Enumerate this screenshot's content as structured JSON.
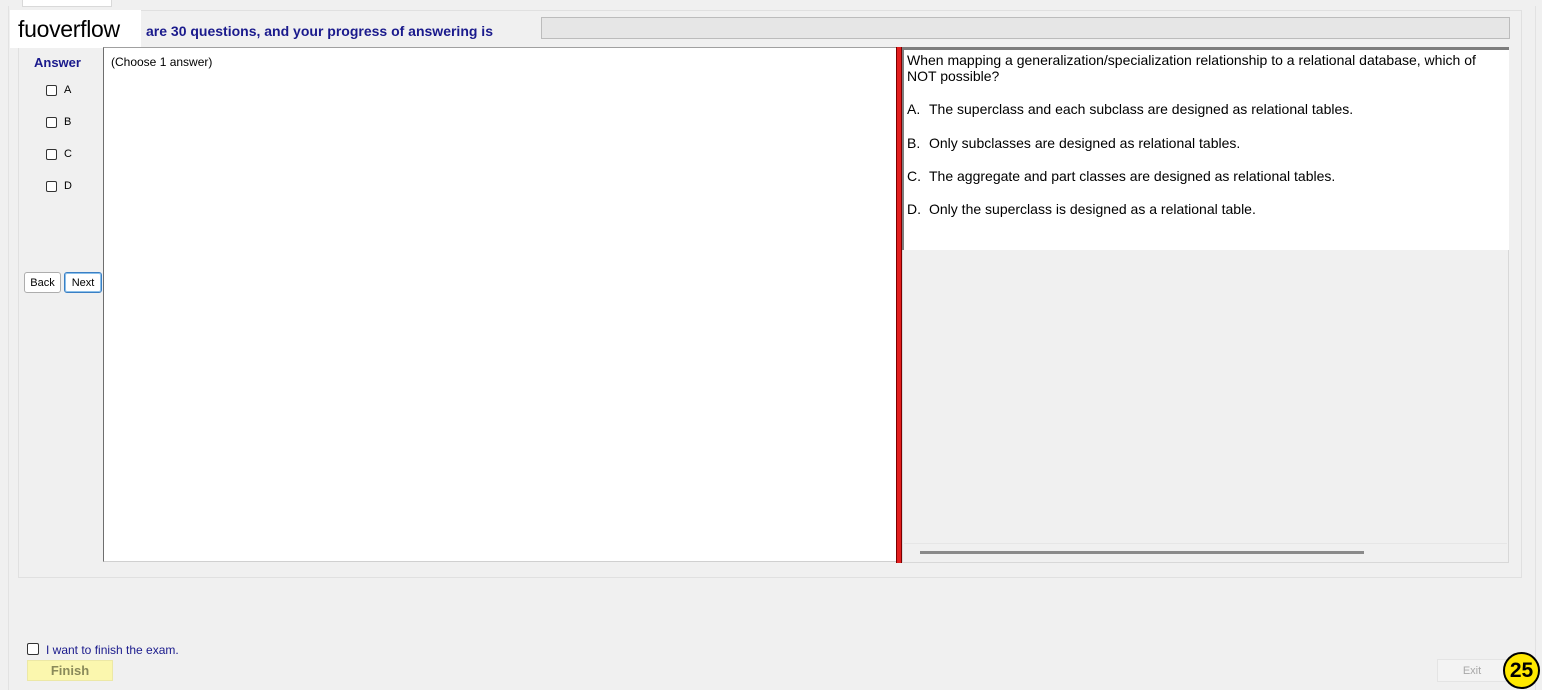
{
  "watermark": "fuoverflow",
  "progress": {
    "text": "are 30 questions, and your progress of answering is",
    "fraction": 0
  },
  "answer_panel": {
    "heading": "Answer",
    "options": [
      "A",
      "B",
      "C",
      "D"
    ],
    "back_label": "Back",
    "next_label": "Next"
  },
  "answer_area": {
    "note": "(Choose 1 answer)"
  },
  "question": {
    "text_line1": "When mapping a generalization/specialization relationship to a relational database, which of",
    "text_line2": "NOT possible?",
    "choices": [
      {
        "letter": "A.",
        "text": "The superclass and each subclass are designed as relational tables."
      },
      {
        "letter": "B.",
        "text": "Only subclasses are designed as relational tables."
      },
      {
        "letter": "C.",
        "text": "The aggregate and part classes are designed as relational tables."
      },
      {
        "letter": "D.",
        "text": "Only the superclass is designed as a relational table."
      }
    ]
  },
  "footer": {
    "finish_check_label": "I want to finish the exam.",
    "finish_label": "Finish",
    "exit_label": "Exit",
    "page_number": "25"
  },
  "colors": {
    "accent_text": "#1a1a8c",
    "splitter": "#e31e1e",
    "finish_button": "#fbf7ae",
    "badge": "#ffe800"
  }
}
